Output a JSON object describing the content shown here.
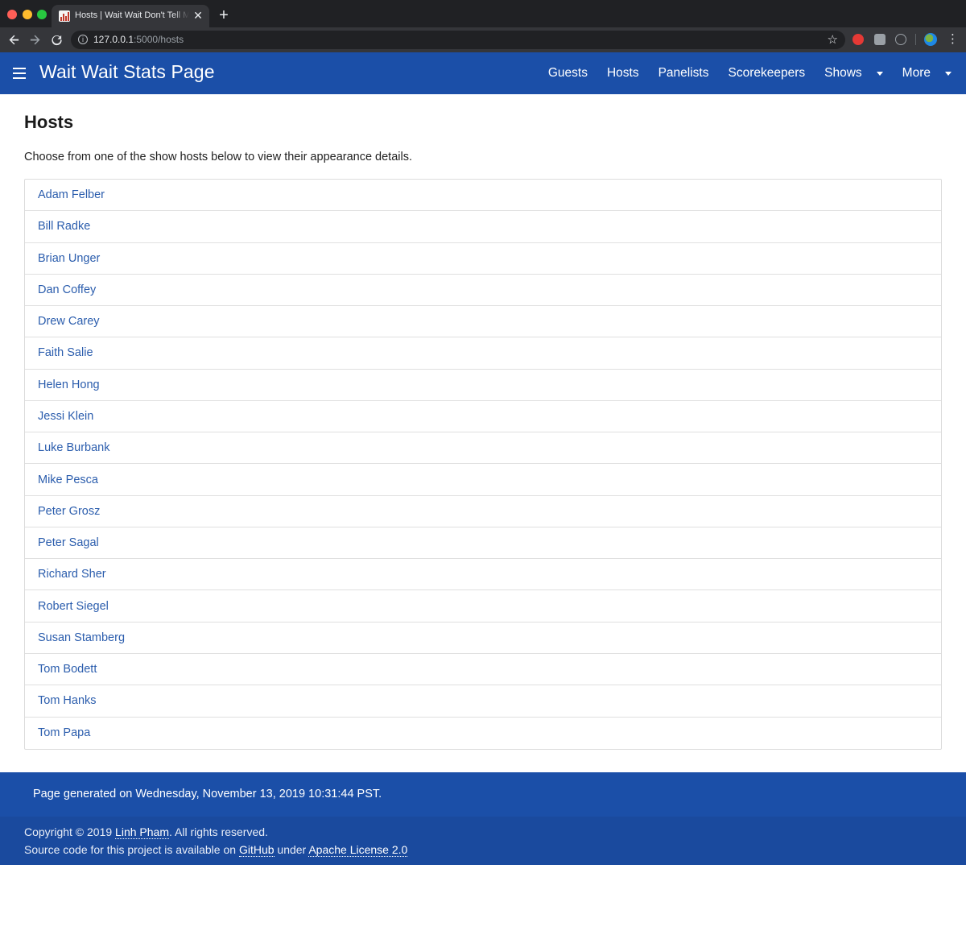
{
  "browser": {
    "tab_title": "Hosts | Wait Wait Don't Tell Me",
    "url_host": "127.0.0.1",
    "url_rest": ":5000/hosts"
  },
  "appbar": {
    "title": "Wait Wait Stats Page",
    "nav": [
      "Guests",
      "Hosts",
      "Panelists",
      "Scorekeepers",
      "Shows",
      "More"
    ]
  },
  "page": {
    "title": "Hosts",
    "description": "Choose from one of the show hosts below to view their appearance details."
  },
  "hosts": [
    "Adam Felber",
    "Bill Radke",
    "Brian Unger",
    "Dan Coffey",
    "Drew Carey",
    "Faith Salie",
    "Helen Hong",
    "Jessi Klein",
    "Luke Burbank",
    "Mike Pesca",
    "Peter Grosz",
    "Peter Sagal",
    "Richard Sher",
    "Robert Siegel",
    "Susan Stamberg",
    "Tom Bodett",
    "Tom Hanks",
    "Tom Papa"
  ],
  "footer": {
    "generated": "Page generated on Wednesday, November 13, 2019 10:31:44 PST.",
    "copyright_prefix": "Copyright © 2019 ",
    "author": "Linh Pham",
    "copyright_suffix": ". All rights reserved.",
    "source_prefix": "Source code for this project is available on ",
    "github": "GitHub",
    "source_mid": " under ",
    "license": "Apache License 2.0"
  },
  "colors": {
    "appbar": "#1b4fa8",
    "link": "#2b5dad"
  }
}
